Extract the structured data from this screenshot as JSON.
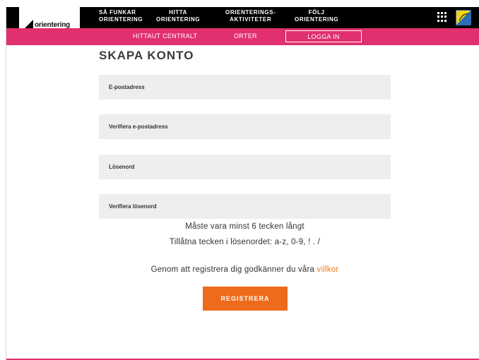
{
  "header": {
    "logo_text": "orientering",
    "nav": [
      {
        "line1": "SÅ FUNKAR",
        "line2": "ORIENTERING"
      },
      {
        "line1": "HITTA",
        "line2": "ORIENTERING"
      },
      {
        "line1": "ORIENTERINGS-",
        "line2": "AKTIVITETER"
      },
      {
        "line1": "FÖLJ",
        "line2": "ORIENTERING"
      }
    ],
    "icons": {
      "apps": "grid-icon",
      "brand": "brand-flag-icon"
    }
  },
  "subnav": {
    "links": [
      "HITTAUT CENTRALT",
      "ORTER"
    ],
    "login_label": "LOGGA IN"
  },
  "form": {
    "title": "SKAPA KONTO",
    "fields": [
      {
        "placeholder": "E-postadress"
      },
      {
        "placeholder": "Verifiera e-postadress"
      },
      {
        "placeholder": "Lösenord"
      },
      {
        "placeholder": "Verifiera lösenord"
      }
    ],
    "hint_length": "Måste vara minst 6 tecken långt",
    "hint_chars": "Tillåtna tecken i lösenordet: a-z, 0-9, ! . /",
    "terms_text": "Genom att registrera dig godkänner du våra",
    "terms_link": "villkor",
    "submit_label": "REGISTRERA"
  },
  "colors": {
    "header_bg": "#000000",
    "accent_pink": "#e0306f",
    "accent_orange": "#ee6a1c",
    "field_bg": "#eeeeee"
  }
}
